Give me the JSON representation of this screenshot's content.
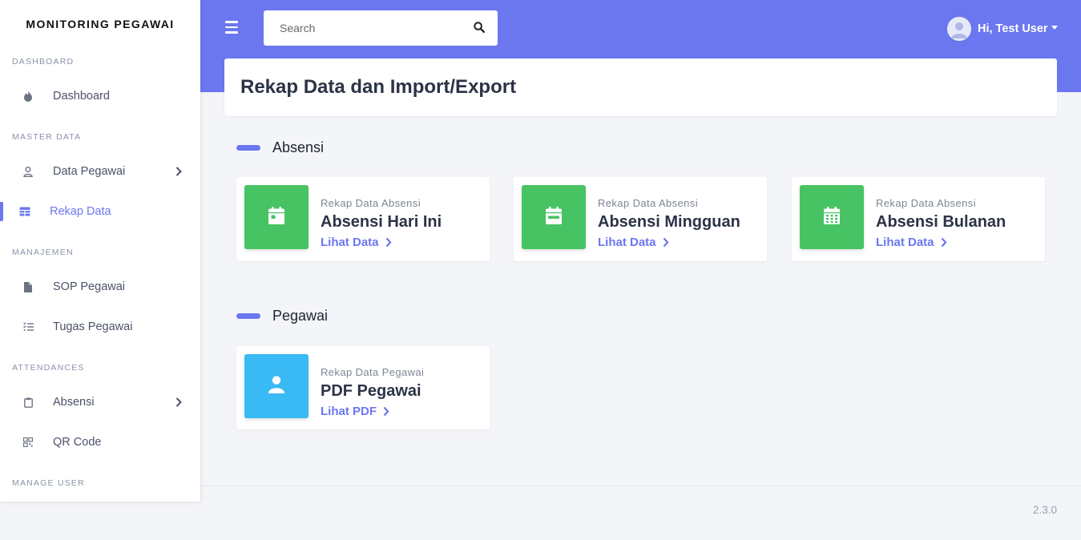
{
  "brand": "MONITORING PEGAWAI",
  "sidebar": {
    "sections": [
      {
        "header": "DASHBOARD"
      },
      {
        "header": "MASTER DATA"
      },
      {
        "header": "MANAJEMEN"
      },
      {
        "header": "ATTENDANCES"
      },
      {
        "header": "MANAGE USER"
      }
    ],
    "items": [
      {
        "label": "Dashboard",
        "icon": "fire-icon"
      },
      {
        "label": "Data Pegawai",
        "icon": "user-icon",
        "has_children": true
      },
      {
        "label": "Rekap Data",
        "icon": "table-icon",
        "active": true
      },
      {
        "label": "SOP Pegawai",
        "icon": "file-icon"
      },
      {
        "label": "Tugas Pegawai",
        "icon": "list-check-icon"
      },
      {
        "label": "Absensi",
        "icon": "clipboard-icon",
        "has_children": true
      },
      {
        "label": "QR Code",
        "icon": "qrcode-icon"
      }
    ]
  },
  "header": {
    "search_placeholder": "Search",
    "user_greeting": "Hi, Test User"
  },
  "page_title": "Rekap Data dan Import/Export",
  "sections": [
    {
      "title": "Absensi",
      "cards": [
        {
          "subtitle": "Rekap Data Absensi",
          "title": "Absensi Hari Ini",
          "link": "Lihat Data",
          "icon": "calendar-day-icon"
        },
        {
          "subtitle": "Rekap Data Absensi",
          "title": "Absensi Mingguan",
          "link": "Lihat Data",
          "icon": "calendar-week-icon"
        },
        {
          "subtitle": "Rekap Data Absensi",
          "title": "Absensi Bulanan",
          "link": "Lihat Data",
          "icon": "calendar-month-icon"
        }
      ]
    },
    {
      "title": "Pegawai",
      "cards": [
        {
          "subtitle": "Rekap Data Pegawai",
          "title": "PDF Pegawai",
          "link": "Lihat PDF",
          "icon": "user-icon"
        }
      ]
    }
  ],
  "footer": {
    "version": "2.3.0"
  },
  "colors": {
    "primary": "#6b77ef",
    "success": "#47c363",
    "info": "#3abaf4"
  }
}
